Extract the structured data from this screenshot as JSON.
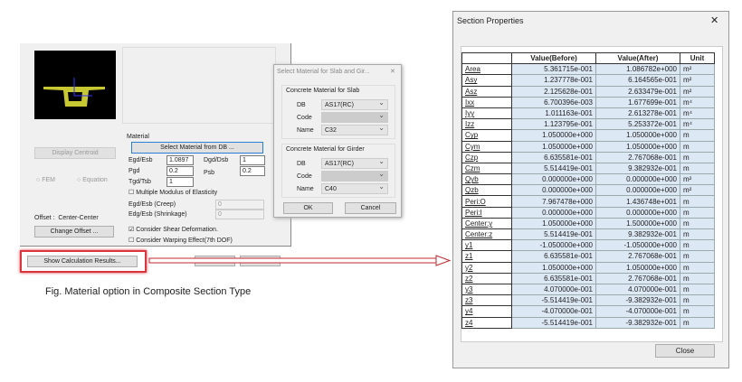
{
  "main_dialog": {
    "display_centroid": "Display Centroid",
    "fem": "FEM",
    "equation": "Equation",
    "offset_label": "Offset :",
    "offset_value": "Center-Center",
    "change_offset": "Change Offset ...",
    "material_label": "Material",
    "select_material": "Select Material from DB ...",
    "egd_esb": "Egd/Esb",
    "egd_esb_val": "1.0897",
    "dgd_dsb": "Dgd/Dsb",
    "dgd_dsb_val": "1",
    "pgd": "Pgd",
    "pgd_val": "0.2",
    "psb": "Psb",
    "psb_val": "0.2",
    "tgd_tsb": "Tgd/Tsb",
    "tgd_tsb_val": "1",
    "multiple_modulus": "Multiple Modulus of Elasticity",
    "creep": "Egd/Esb (Creep)",
    "creep_val": "0",
    "shrinkage": "Edg/Esb (Shrinkage)",
    "shrinkage_val": "0",
    "shear_def": "Consider Shear Deformation.",
    "shear_def_checked": true,
    "warping": "Consider Warping Effect(7th DOF)",
    "warping_checked": false,
    "show_results": "Show Calculation Results..."
  },
  "material_dialog": {
    "title": "Select Material for Slab and Gir...",
    "slab_group": "Concrete Material for Slab",
    "girder_group": "Concrete Material for Girder",
    "db": "DB",
    "code": "Code",
    "name": "Name",
    "slab_db": "AS17(RC)",
    "slab_name": "C32",
    "girder_db": "AS17(RC)",
    "girder_name": "C40",
    "ok": "OK",
    "cancel": "Cancel"
  },
  "caption": "Fig. Material option in Composite Section Type",
  "section_properties": {
    "title": "Section Properties",
    "headers": [
      "",
      "Value(Before)",
      "Value(After)",
      "Unit"
    ],
    "rows": [
      [
        "Area",
        "5.361715e-001",
        "1.086782e+000",
        "m²"
      ],
      [
        "Asy",
        "1.237778e-001",
        "6.164565e-001",
        "m²"
      ],
      [
        "Asz",
        "2.125628e-001",
        "2.633479e-001",
        "m²"
      ],
      [
        "Ixx",
        "6.700396e-003",
        "1.677699e-001",
        "m⁴"
      ],
      [
        "Iyy",
        "1.011163e-001",
        "2.613278e-001",
        "m⁴"
      ],
      [
        "Izz",
        "1.123795e-001",
        "5.253372e-001",
        "m⁴"
      ],
      [
        "Cyp",
        "1.050000e+000",
        "1.050000e+000",
        "m"
      ],
      [
        "Cym",
        "1.050000e+000",
        "1.050000e+000",
        "m"
      ],
      [
        "Czp",
        "6.635581e-001",
        "2.767068e-001",
        "m"
      ],
      [
        "Czm",
        "5.514419e-001",
        "9.382932e-001",
        "m"
      ],
      [
        "Qyb",
        "0.000000e+000",
        "0.000000e+000",
        "m²"
      ],
      [
        "Qzb",
        "0.000000e+000",
        "0.000000e+000",
        "m²"
      ],
      [
        "Peri:O",
        "7.967478e+000",
        "1.436748e+001",
        "m"
      ],
      [
        "Peri:I",
        "0.000000e+000",
        "0.000000e+000",
        "m"
      ],
      [
        "Center:y",
        "1.050000e+000",
        "1.500000e+000",
        "m"
      ],
      [
        "Center:z",
        "5.514419e-001",
        "9.382932e-001",
        "m"
      ],
      [
        "y1",
        "-1.050000e+000",
        "-1.050000e+000",
        "m"
      ],
      [
        "z1",
        "6.635581e-001",
        "2.767068e-001",
        "m"
      ],
      [
        "y2",
        "1.050000e+000",
        "1.050000e+000",
        "m"
      ],
      [
        "z2",
        "6.635581e-001",
        "2.767068e-001",
        "m"
      ],
      [
        "y3",
        "4.070000e-001",
        "4.070000e-001",
        "m"
      ],
      [
        "z3",
        "-5.514419e-001",
        "-9.382932e-001",
        "m"
      ],
      [
        "y4",
        "-4.070000e-001",
        "-4.070000e-001",
        "m"
      ],
      [
        "z4",
        "-5.514419e-001",
        "-9.382932e-001",
        "m"
      ]
    ],
    "close": "Close",
    "close_icon": "x-icon"
  },
  "colors": {
    "highlight": "#d9363e",
    "section": "#c8c832",
    "table_cell": "#dde8f5"
  }
}
